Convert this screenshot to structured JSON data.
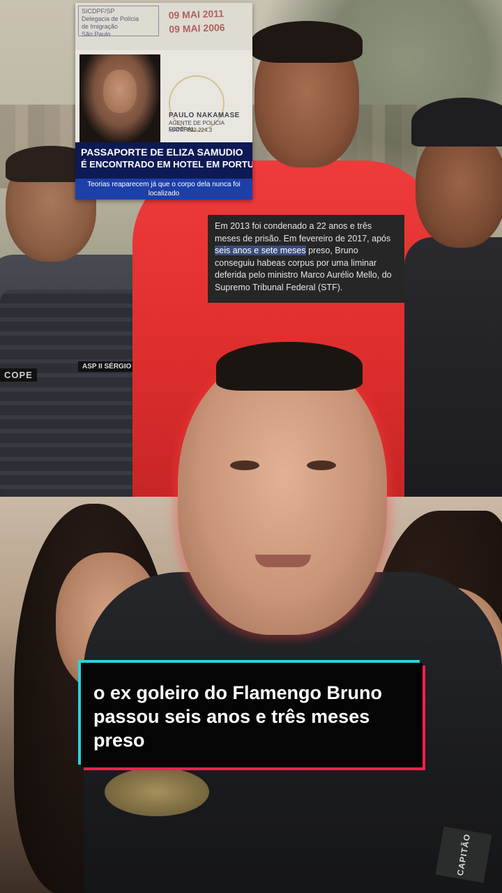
{
  "passport_card": {
    "stamp_top": [
      "SICDPF/SP",
      "Delegacia de Polícia",
      "de Imigração",
      "São Paulo"
    ],
    "stamp_date_1": "09 MAI 2011",
    "stamp_date_2": "09 MAI 2006",
    "agent_name": "PAULO NAKAMASE",
    "agent_role": "AGENTE DE POLÍCIA FEDERAL",
    "agent_matricula": "MATR. 022.224.3",
    "headline_line1": "PASSAPORTE DE ELIZA SAMUDIO",
    "headline_line2": "É ENCONTRADO EM HOTEL EM PORTUGAL",
    "subheadline": "Teorias reaparecem já que o corpo dela nunca foi localizado"
  },
  "photo_labels": {
    "name_tag": "ASP II SÉRGIO",
    "unit_tag": "COPE"
  },
  "news_box": {
    "text_before": "Em 2013 foi condenado a 22 anos e três meses de prisão. Em fevereiro de 2017, após ",
    "highlight": "seis anos e sete meses",
    "text_after": " preso, Bruno conseguiu habeas corpus por uma liminar deferida pelo ministro Marco Aurélio Mello, do Supremo Tribunal Federal (STF)."
  },
  "caption": {
    "text": " o ex goleiro do Flamengo Bruno passou seis anos e três meses preso",
    "colors": {
      "shadow_cyan": "#29d3e0",
      "shadow_red": "#f5214f",
      "box": "#050505"
    }
  },
  "uniform_tag": "CAPITÃO"
}
